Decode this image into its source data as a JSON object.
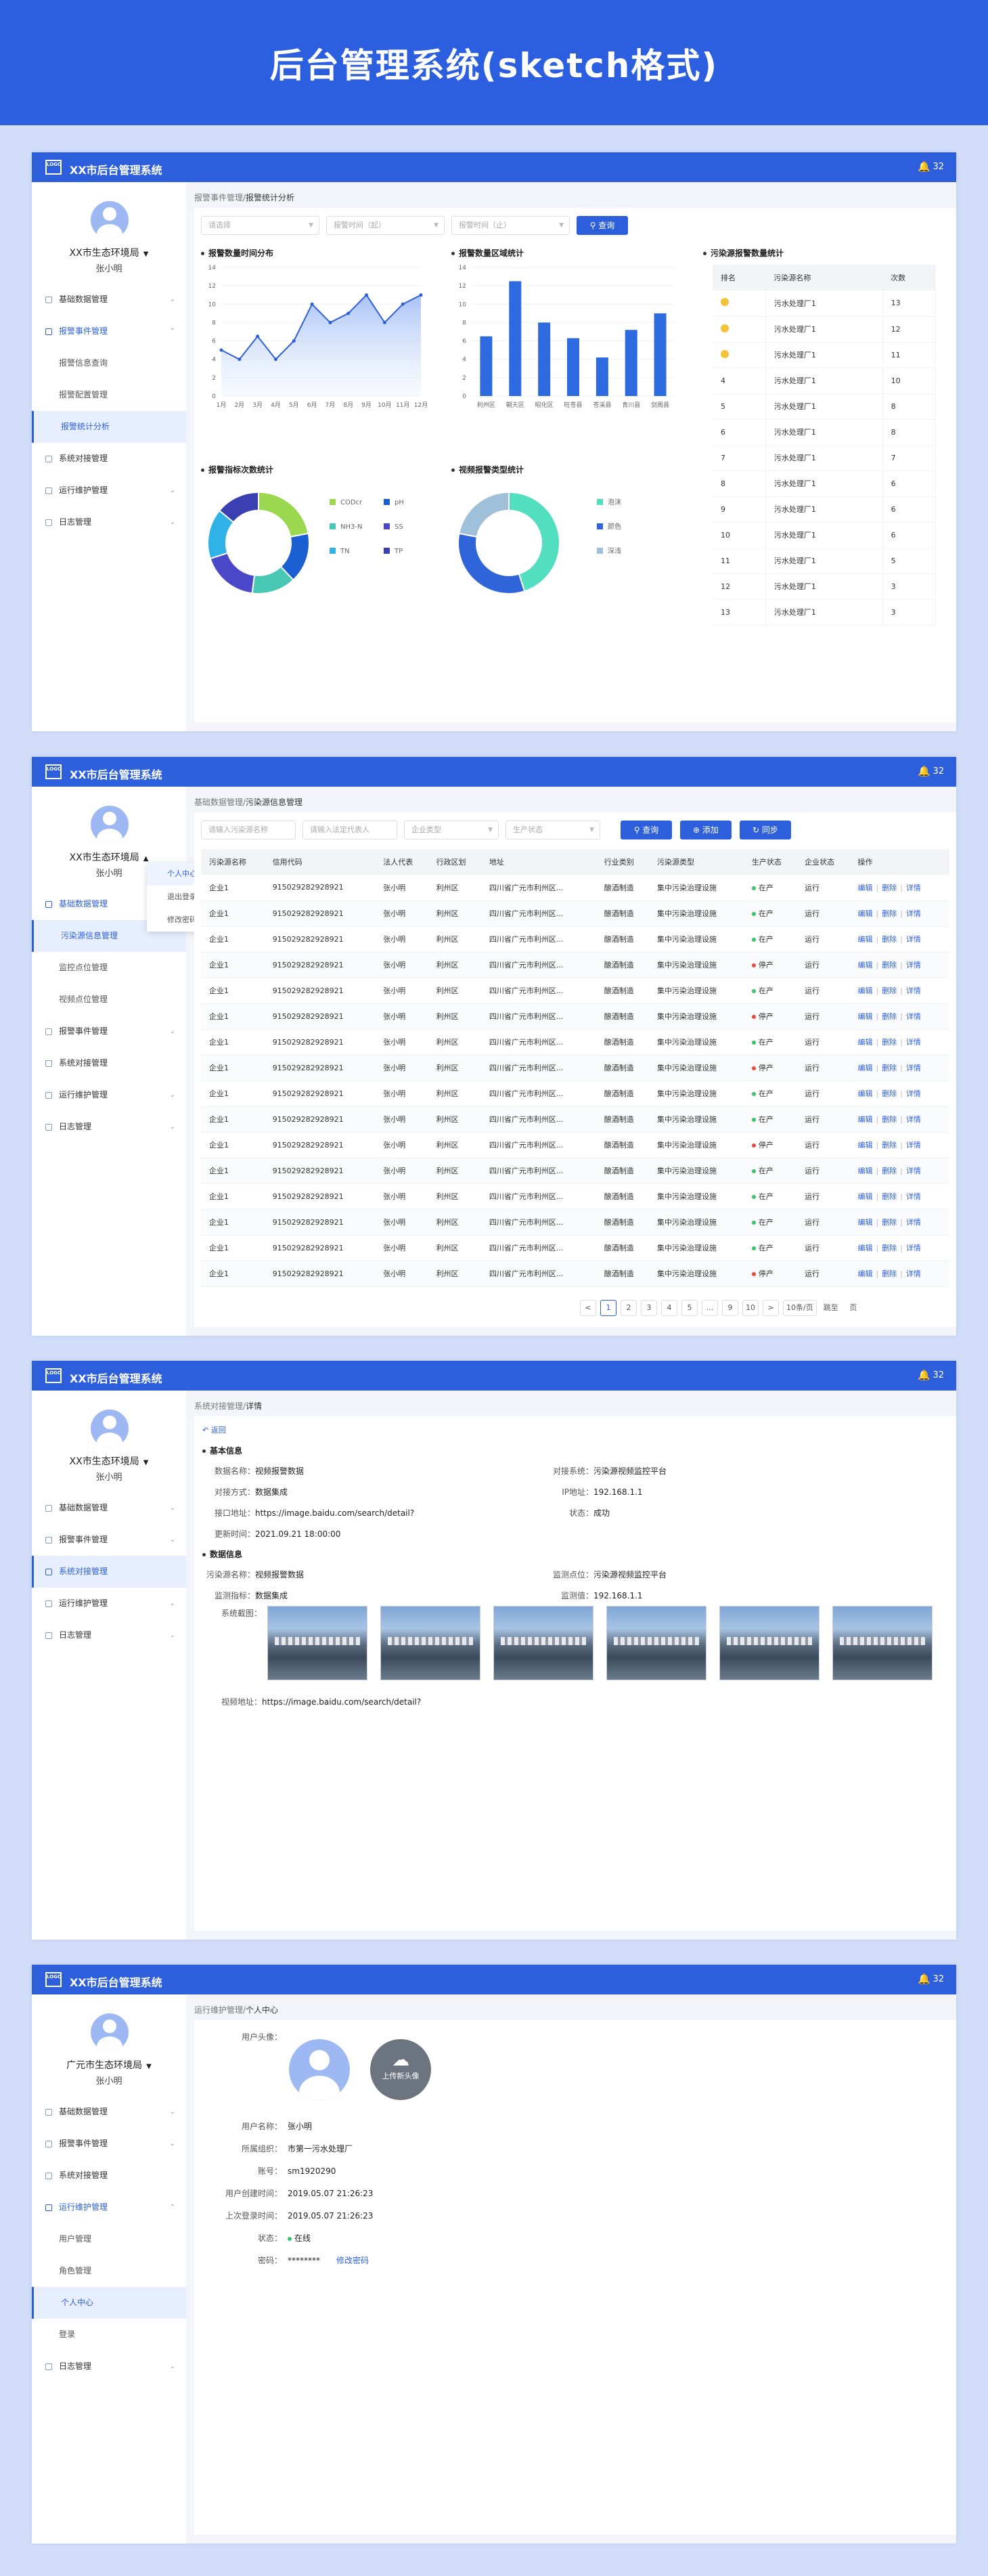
{
  "banner": {
    "title": "后台管理系统(sketch格式)"
  },
  "app": {
    "logo": "LOGO",
    "title": "XX市后台管理系统",
    "bell_count": "32"
  },
  "screen1": {
    "org": "XX市生态环境局",
    "user": "张小明",
    "menu": [
      "基础数据管理",
      "报警事件管理",
      "报警信息查询",
      "报警配置管理",
      "报警统计分析",
      "系统对接管理",
      "运行维护管理",
      "日志管理"
    ],
    "crumb_a": "报警事件管理/",
    "crumb_b": "报警统计分析",
    "filters": [
      "请选择",
      "报警时间（起）",
      "报警时间（止）"
    ],
    "query": "查询",
    "line_title": "报警数量时间分布",
    "bar_title": "报警数量区域统计",
    "rank_title": "污染源报警数量统计",
    "donut1_title": "报警指标次数统计",
    "donut2_title": "视频报警类型统计",
    "rank_head": [
      "排名",
      "污染源名称",
      "次数"
    ],
    "rank_name": "污水处理厂1",
    "rank_rows": [
      [
        "1",
        "13"
      ],
      [
        "2",
        "12"
      ],
      [
        "3",
        "11"
      ],
      [
        "4",
        "10"
      ],
      [
        "5",
        "8"
      ],
      [
        "6",
        "8"
      ],
      [
        "7",
        "7"
      ],
      [
        "8",
        "6"
      ],
      [
        "9",
        "6"
      ],
      [
        "10",
        "6"
      ],
      [
        "11",
        "5"
      ],
      [
        "12",
        "3"
      ],
      [
        "13",
        "3"
      ]
    ]
  },
  "chart_data": [
    {
      "type": "line",
      "title": "报警数量时间分布",
      "categories": [
        "1月",
        "2月",
        "3月",
        "4月",
        "5月",
        "6月",
        "7月",
        "8月",
        "9月",
        "10月",
        "11月",
        "12月"
      ],
      "values": [
        5,
        4,
        6.5,
        4,
        6,
        10,
        8,
        9,
        11,
        8,
        10,
        11
      ],
      "ylim": [
        0,
        14
      ],
      "yticks": [
        0,
        2,
        4,
        6,
        8,
        10,
        12,
        14
      ],
      "color": "#2d5fdc"
    },
    {
      "type": "bar",
      "title": "报警数量区域统计",
      "categories": [
        "利州区",
        "朝天区",
        "昭化区",
        "旺苍县",
        "苍溪县",
        "青川县",
        "剑阁县"
      ],
      "values": [
        6.5,
        12.5,
        8,
        6.3,
        4.2,
        7.2,
        9
      ],
      "ylim": [
        0,
        14
      ],
      "yticks": [
        0,
        2,
        4,
        6,
        8,
        10,
        12,
        14
      ],
      "color": "#2d6ae0"
    },
    {
      "type": "pie",
      "title": "报警指标次数统计",
      "labels": [
        "CODcr",
        "pH",
        "NH3-N",
        "SS",
        "TN",
        "TP"
      ],
      "values": [
        22,
        16,
        14,
        18,
        16,
        14
      ],
      "colors": [
        "#9bd84f",
        "#1a5fd2",
        "#49c7b5",
        "#4a48c8",
        "#2fb2e6",
        "#3a3fb2"
      ]
    },
    {
      "type": "pie",
      "title": "视频报警类型统计",
      "labels": [
        "泡沫",
        "颜色",
        "深浅"
      ],
      "values": [
        45,
        33,
        22
      ],
      "colors": [
        "#52dfbf",
        "#2f65d8",
        "#9fc0d8"
      ]
    }
  ],
  "screen2": {
    "org": "XX市生态环境局",
    "user": "张小明",
    "dropdown": [
      "个人中心",
      "退出登录",
      "修改密码"
    ],
    "menu": [
      "基础数据管理",
      "污染源信息管理",
      "监控点位管理",
      "视频点位管理",
      "报警事件管理",
      "系统对接管理",
      "运行维护管理",
      "日志管理"
    ],
    "crumb_a": "基础数据管理/",
    "crumb_b": "污染源信息管理",
    "filters": [
      "请输入污染源名称",
      "请输入法定代表人",
      "企业类型",
      "生产状态"
    ],
    "btns": [
      "查询",
      "添加",
      "同步"
    ],
    "head": [
      "污染源名称",
      "信用代码",
      "法人代表",
      "行政区划",
      "地址",
      "行业类别",
      "污染源类型",
      "生产状态",
      "企业状态",
      "操作"
    ],
    "row": {
      "name": "企业1",
      "code": "915029282928921",
      "rep": "张小明",
      "area": "利州区",
      "addr": "四川省广元市利州区...",
      "ind": "酿酒制造",
      "type": "集中污染治理设施",
      "estate": "运行",
      "ops": [
        "编辑",
        "删除",
        "详情"
      ]
    },
    "status": [
      "在产",
      "在产",
      "在产",
      "停产",
      "在产",
      "停产",
      "在产",
      "停产",
      "在产",
      "在产",
      "停产",
      "在产",
      "在产",
      "在产",
      "在产",
      "停产"
    ],
    "status_colors": {
      "在产": "#3cc16d",
      "停产": "#e8493a"
    },
    "pager": [
      "<",
      "1",
      "2",
      "3",
      "4",
      "5",
      "...",
      "9",
      "10",
      ">",
      "10条/页",
      "跳至",
      "页"
    ]
  },
  "screen3": {
    "org": "XX市生态环境局",
    "user": "张小明",
    "menu": [
      "基础数据管理",
      "报警事件管理",
      "系统对接管理",
      "运行维护管理",
      "日志管理"
    ],
    "crumb_a": "系统对接管理/",
    "crumb_b": "详情",
    "back": "返回",
    "sec1": "基本信息",
    "sec2": "数据信息",
    "b_l": [
      [
        "数据名称：",
        "视频报警数据"
      ],
      [
        "对接方式：",
        "数据集成"
      ],
      [
        "接口地址：",
        "https://image.baidu.com/search/detail?"
      ],
      [
        "更新时间：",
        "2021.09.21 18:00:00"
      ]
    ],
    "b_r": [
      [
        "对接系统：",
        "污染源视频监控平台"
      ],
      [
        "IP地址：",
        "192.168.1.1"
      ],
      [
        "状态：",
        "成功"
      ]
    ],
    "d_l": [
      [
        "污染源名称：",
        "视频报警数据"
      ],
      [
        "监测指标：",
        "数据集成"
      ]
    ],
    "d_r": [
      [
        "监测点位：",
        "污染源视频监控平台"
      ],
      [
        "监测值：",
        "192.168.1.1"
      ]
    ],
    "shot_label": "系统截图：",
    "video_label": "视频地址：",
    "video_url": "https://image.baidu.com/search/detail?"
  },
  "screen4": {
    "org": "广元市生态环境局",
    "user": "张小明",
    "menu": [
      "基础数据管理",
      "报警事件管理",
      "系统对接管理",
      "运行维护管理",
      "用户管理",
      "角色管理",
      "个人中心",
      "登录",
      "日志管理"
    ],
    "crumb_a": "运行维护管理/",
    "crumb_b": "个人中心",
    "avatar_label": "用户头像：",
    "upload": "上传新头像",
    "fields": [
      [
        "用户名称：",
        "张小明"
      ],
      [
        "所属组织：",
        "市第一污水处理厂"
      ],
      [
        "账号：",
        "sm1920290"
      ],
      [
        "用户创建时间：",
        "2019.05.07 21:26:23"
      ],
      [
        "上次登录时间：",
        "2019.05.07 21:26:23"
      ],
      [
        "状态：",
        "在线"
      ],
      [
        "密码：",
        "********"
      ]
    ],
    "change_pwd": "修改密码"
  }
}
